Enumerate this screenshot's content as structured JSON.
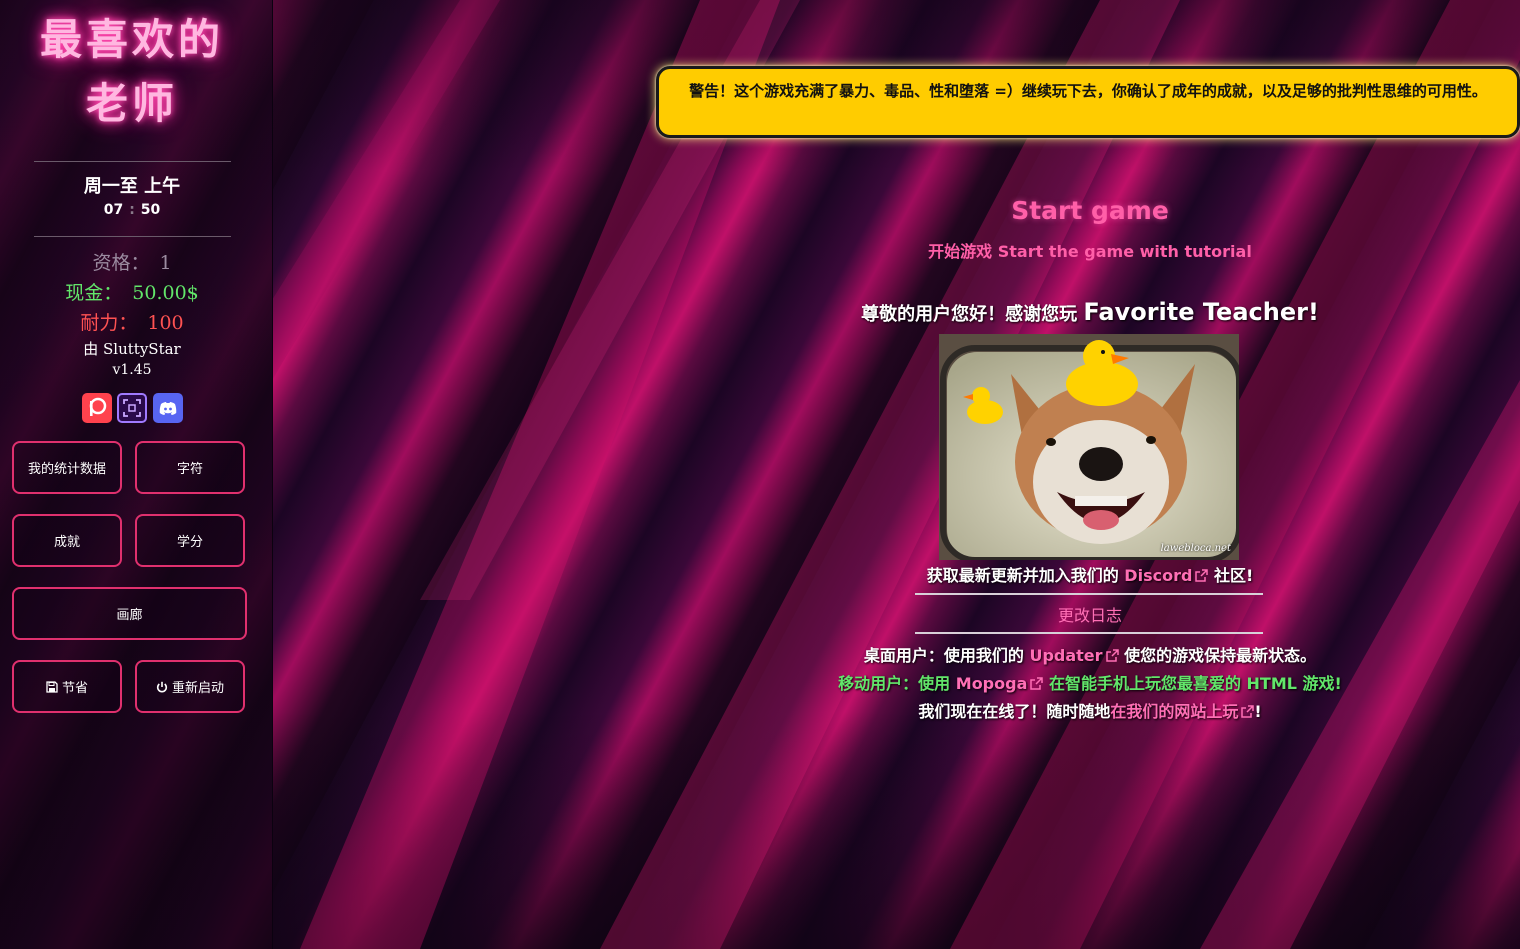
{
  "sidebar": {
    "brand": "最喜欢的老师",
    "day": "周一至 上午",
    "time": {
      "hour": "07",
      "sep": ":",
      "minute": "50"
    },
    "stats": {
      "qualification": {
        "label": "资格：",
        "value": "1"
      },
      "cash": {
        "label": "现金：",
        "value": "50.00$"
      },
      "stamina": {
        "label": "耐力：",
        "value": "100"
      }
    },
    "author": "由 SluttyStar",
    "version": "v1.45",
    "social": [
      "patreon-icon",
      "itch-icon",
      "discord-icon"
    ],
    "buttons": {
      "stats": "我的统计数据",
      "characters": "字符",
      "achievements": "成就",
      "credits": "学分",
      "gallery": "画廊",
      "save": "节省",
      "restart": "重新启动"
    }
  },
  "main": {
    "warning": "警告！这个游戏充满了暴力、毒品、性和堕落 =）继续玩下去，你确认了成年的成就，以及足够的批判性思维的可用性。",
    "start_title": "Start game",
    "start_sub": "开始游戏 Start the game with tutorial",
    "welcome_prefix": "尊敬的用户您好！感谢您玩",
    "welcome_game": "Favorite Teacher!",
    "photo_watermark": "lawebloca.net",
    "discord_pre": "获取最新更新并加入我们的",
    "discord_link": "Discord",
    "discord_post": "社区!",
    "changelog": "更改日志",
    "desktop_pre": "桌面用户：使用我们的",
    "desktop_link": "Updater",
    "desktop_post": "使您的游戏保持最新状态。",
    "mobile_pre": "移动用户：使用",
    "mobile_link": "Mopoga",
    "mobile_post": "在智能手机上玩您最喜爱的 HTML 游戏!",
    "online_pre": "我们现在在线了！随时随地",
    "online_link": "在我们的网站上玩",
    "online_post": "!"
  },
  "colors": {
    "accent_pink": "#ff5fa8",
    "warning_yellow": "#ffcc00",
    "cash_green": "#62e66a",
    "stamina_red": "#ff5252",
    "button_border": "#e0306e"
  }
}
